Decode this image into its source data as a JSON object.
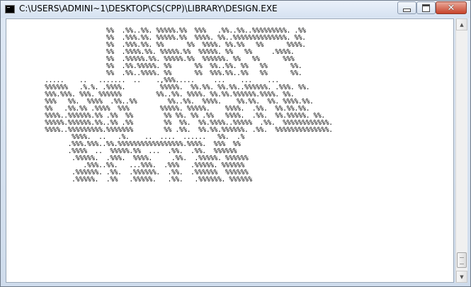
{
  "window": {
    "title": "C:\\USERS\\ADMINI~1\\DESKTOP\\CS(CPP)\\LIBRARY\\DESIGN.EXE",
    "icon": "console-app-icon"
  },
  "controls": {
    "minimize": "minimize-icon",
    "maximize": "maximize-icon",
    "close": "✕"
  },
  "console": {
    "text": "                          %%  .%%..%%. %%%%%.%%  %%%   .%%..%%..%%%%%%%%%. .%%\n                          %%  .%%%.%%. %%%%%.%%  %%%%. %%..%%%%%%%%%%%%%%. %%.\n                          %%  .%%%.%%. %%      %%  %%%%. %%.%%   %%      %%%%.\n                          %%  .%%%%.%%. %%%%%.%%  %%%%%. %%   %%     .%%%%.\n                          %%  .%%%%%.%%. %%%%%.%%  %%%%%%. %%   %%      %%%\n                          %%  .%%.%%%%%. %%      %%  %%..%%. %%   %%      %%.\n                          %%  .%%..%%%%. %%      %%  %%%.%%..%%   %%      %%.\n          .....    ..   .......  ..    .,%%%.....     ...    ...    ...\n          %%%%%%   .%.%. .%%%%.         %%%%%.  %%.%%. %%.%%..%%%%%%. .%%%. %%.\n          %%%.%%%. %%%. %%%%%%         %%..%%. %%%%. %%.%%.%%%%%%.%%%%. %%.\n          %%%   %%.  %%%%  .%%..%%        %%..%%.  %%%%.    %%.%%.  %%. %%%%.%%.\n          %%   .%%.%% .%%%%  %%%        %%%%%. %%%%%.    %%%%.  .%%.  %%.%%.%%.\n          %%%%..%%%%%%.%% .%%  %%        %% %%. %% .%%   %%%%.  .%%.  %%.%%%%%. %%.\n          %%%%%.%%%%%%.%%..%% .%%        %%  %%.  %%.%%%%..%%%%%  .%%.  %%%%%%%%%%%%.\n          %%%%..%%%%%%%%%.%%%%%%%        %% .%%.  %%.%%.%%%%%%. .%%.  %%%%%%%%%%%%%%.\n                 %%%%.  ..   .%.    ..  ....  ......   %%.  .%\n                .%%%.%%%..%%.%%%%%%%%%%%%%%%%%.%%%%.  %%%  %%\n                .%%%%  ..  %%%%%.%%  ...  .%%.  .%%.  %%%%%%\n                 .%%%%%.  .%%%.  %%%%.     .%%.  .%%%%%. %%%%%%\n                    .%%%..%%.   ...%%%.  .%%%   .%%%%%. %%%%%%\n                 .%%%%%%. .%%.  .%%%%%%.  .%%.  .%%%%%%  %%%%%%\n                 .%%%%%.  .%%   .%%%%%.   .%%.   .%%%%%%. %%%%%%"
  }
}
